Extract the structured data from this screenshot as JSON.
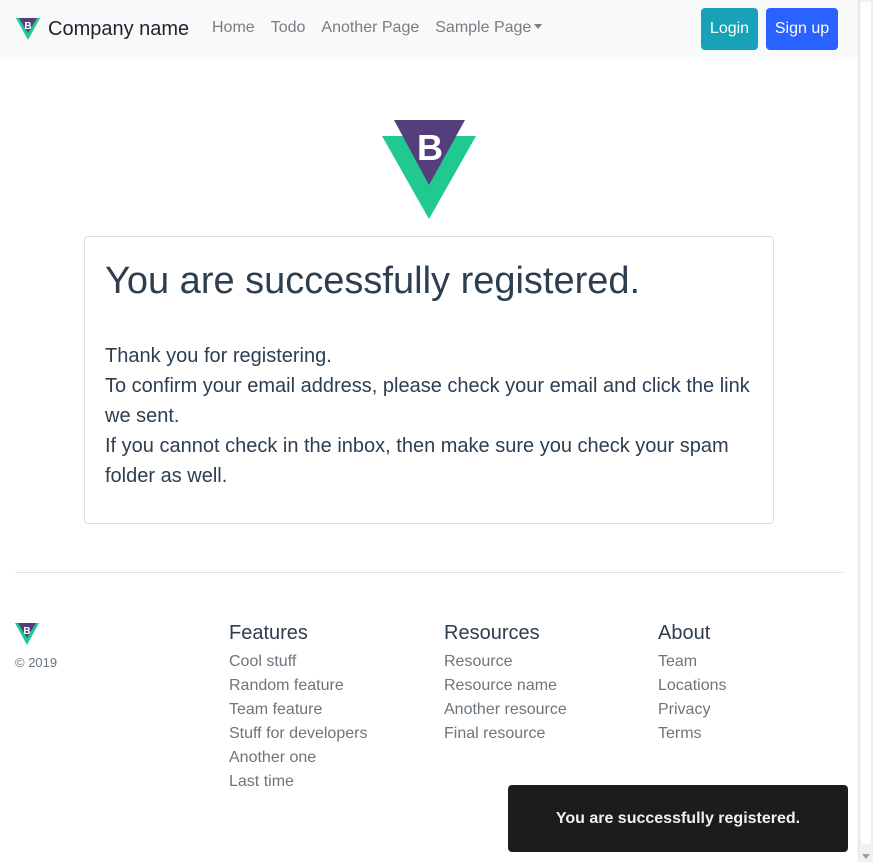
{
  "navbar": {
    "brand": "Company name",
    "links": [
      "Home",
      "Todo",
      "Another Page",
      "Sample Page"
    ],
    "login_label": "Login",
    "signup_label": "Sign up",
    "icons": {
      "brand": "bootstrap-vue-logo-icon",
      "dropdown": "caret-down-icon"
    }
  },
  "main": {
    "title": "You are successfully registered.",
    "lines": [
      "Thank you for registering.",
      "To confirm your email address, please check your email and click the link we sent.",
      "If you cannot check in the inbox, then make sure you check your spam folder as well."
    ]
  },
  "footer": {
    "copyright": "© 2019",
    "columns": [
      {
        "heading": "Features",
        "links": [
          "Cool stuff",
          "Random feature",
          "Team feature",
          "Stuff for developers",
          "Another one",
          "Last time"
        ]
      },
      {
        "heading": "Resources",
        "links": [
          "Resource",
          "Resource name",
          "Another resource",
          "Final resource"
        ]
      },
      {
        "heading": "About",
        "links": [
          "Team",
          "Locations",
          "Privacy",
          "Terms"
        ]
      }
    ]
  },
  "toast": {
    "message": "You are successfully registered."
  },
  "colors": {
    "login": "#17a2b8",
    "signup": "#2962ff",
    "logo_purple": "#563d7c",
    "logo_green": "#1fc98f",
    "toast_bg": "#1c1c1c"
  }
}
